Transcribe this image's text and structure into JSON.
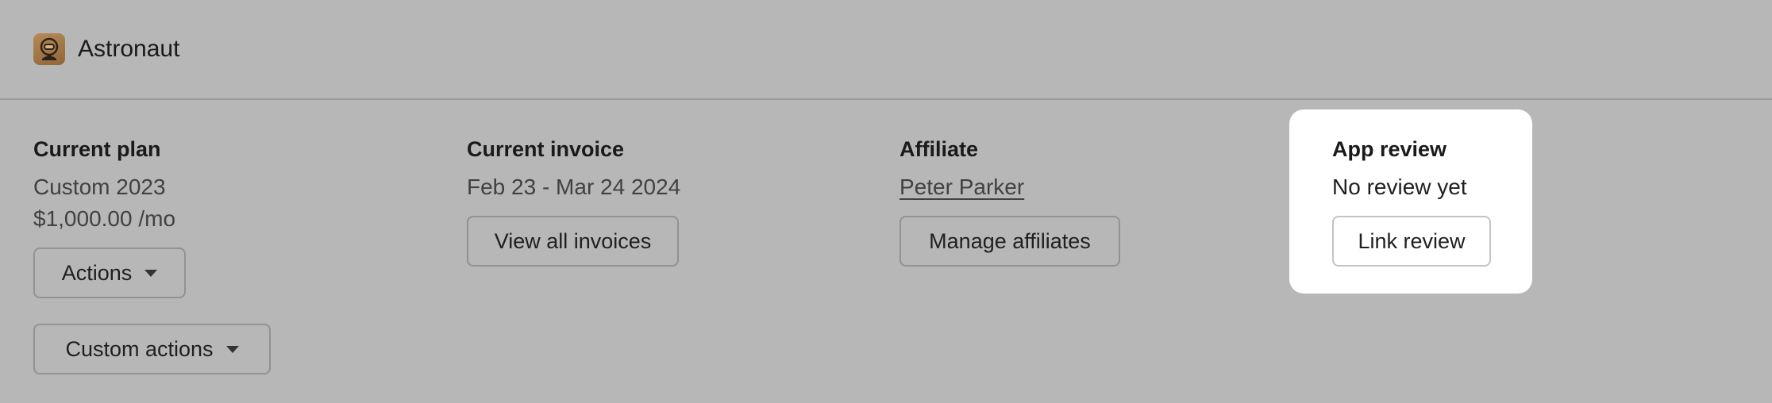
{
  "header": {
    "app_name": "Astronaut",
    "app_icon": "astronaut-icon"
  },
  "current_plan": {
    "heading": "Current plan",
    "plan_name": "Custom 2023",
    "price": "$1,000.00 /mo",
    "actions_label": "Actions",
    "custom_actions_label": "Custom actions"
  },
  "current_invoice": {
    "heading": "Current invoice",
    "period": "Feb 23 - Mar 24 2024",
    "view_all_label": "View all invoices"
  },
  "affiliate": {
    "heading": "Affiliate",
    "name": "Peter Parker",
    "manage_label": "Manage affiliates"
  },
  "app_review": {
    "heading": "App review",
    "status": "No review yet",
    "link_label": "Link review"
  },
  "colors": {
    "overlay_background": "#b7b7b7",
    "highlight_card": "#ffffff",
    "app_icon": "#a47a48"
  }
}
